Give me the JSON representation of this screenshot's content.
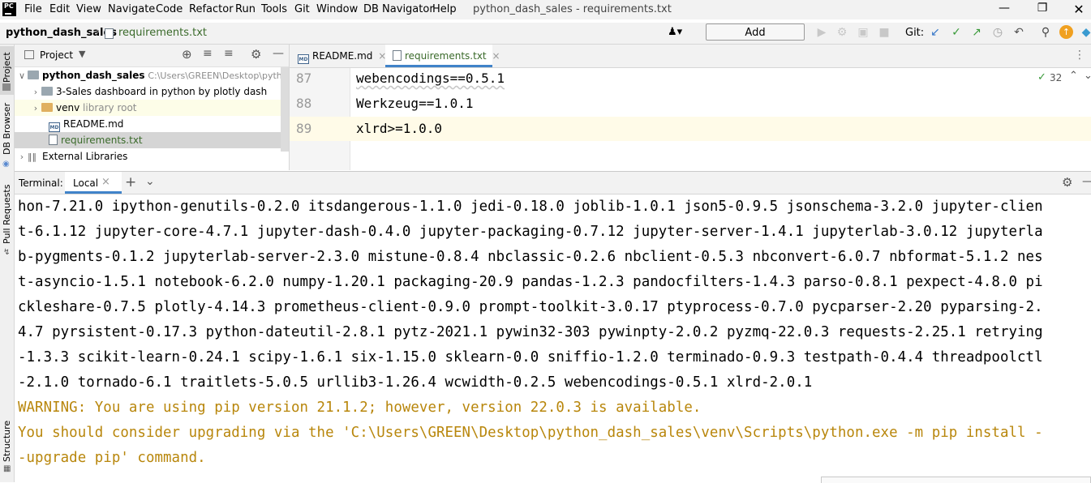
{
  "menubar": {
    "items": [
      "File",
      "Edit",
      "View",
      "Navigate",
      "Code",
      "Refactor",
      "Run",
      "Tools",
      "Git",
      "Window",
      "DB Navigator",
      "Help"
    ],
    "window_title": "python_dash_sales - requirements.txt",
    "logo": "PC"
  },
  "navbar": {
    "project": "python_dash_sales",
    "file": "requirements.txt",
    "add_configuration": "Add Configuration...",
    "git_label": "Git:"
  },
  "left_strip": {
    "project": "Project",
    "db_browser": "DB Browser",
    "pull_requests": "Pull Requests",
    "structure": "Structure"
  },
  "project_panel": {
    "title": "Project",
    "rows": [
      {
        "label": "python_dash_sales",
        "hint": "C:\\Users\\GREEN\\Desktop\\pytho"
      },
      {
        "label": "3-Sales dashboard in python by plotly dash",
        "hint": ""
      },
      {
        "label": "venv",
        "hint": "library root"
      },
      {
        "label": "README.md",
        "hint": ""
      },
      {
        "label": "requirements.txt",
        "hint": ""
      },
      {
        "label": "External Libraries",
        "hint": ""
      }
    ]
  },
  "editor": {
    "tabs": [
      {
        "label": "README.md",
        "active": false
      },
      {
        "label": "requirements.txt",
        "active": true
      }
    ],
    "inspection_count": "32",
    "lines": [
      {
        "num": "87",
        "text": "webencodings==0.5.1"
      },
      {
        "num": "88",
        "text": "Werkzeug==1.0.1"
      },
      {
        "num": "89",
        "text": "xlrd>=1.0.0"
      }
    ]
  },
  "terminal": {
    "label": "Terminal:",
    "tab": "Local",
    "lines": [
      "hon-7.21.0 ipython-genutils-0.2.0 itsdangerous-1.1.0 jedi-0.18.0 joblib-1.0.1 json5-0.9.5 jsonschema-3.2.0 jupyter-clien",
      "t-6.1.12 jupyter-core-4.7.1 jupyter-dash-0.4.0 jupyter-packaging-0.7.12 jupyter-server-1.4.1 jupyterlab-3.0.12 jupyterla",
      "b-pygments-0.1.2 jupyterlab-server-2.3.0 mistune-0.8.4 nbclassic-0.2.6 nbclient-0.5.3 nbconvert-6.0.7 nbformat-5.1.2 nes",
      "t-asyncio-1.5.1 notebook-6.2.0 numpy-1.20.1 packaging-20.9 pandas-1.2.3 pandocfilters-1.4.3 parso-0.8.1 pexpect-4.8.0 pi",
      "ckleshare-0.7.5 plotly-4.14.3 prometheus-client-0.9.0 prompt-toolkit-3.0.17 ptyprocess-0.7.0 pycparser-2.20 pyparsing-2.",
      "4.7 pyrsistent-0.17.3 python-dateutil-2.8.1 pytz-2021.1 pywin32-303 pywinpty-2.0.2 pyzmq-22.0.3 requests-2.25.1 retrying",
      "-1.3.3 scikit-learn-0.24.1 scipy-1.6.1 six-1.15.0 sklearn-0.0 sniffio-1.2.0 terminado-0.9.3 testpath-0.4.4 threadpoolctl",
      "-2.1.0 tornado-6.1 traitlets-5.0.5 urllib3-1.26.4 wcwidth-0.2.5 webencodings-0.5.1 xlrd-2.0.1"
    ],
    "warnings": [
      "WARNING: You are using pip version 21.1.2; however, version 22.0.3 is available.",
      "You should consider upgrading via the 'C:\\Users\\GREEN\\Desktop\\python_dash_sales\\venv\\Scripts\\python.exe -m pip install -",
      "-upgrade pip' command."
    ]
  },
  "colors": {
    "warning": "#b8860b",
    "accent_green": "#3a6a2a",
    "selection": "#d5d5d5"
  }
}
